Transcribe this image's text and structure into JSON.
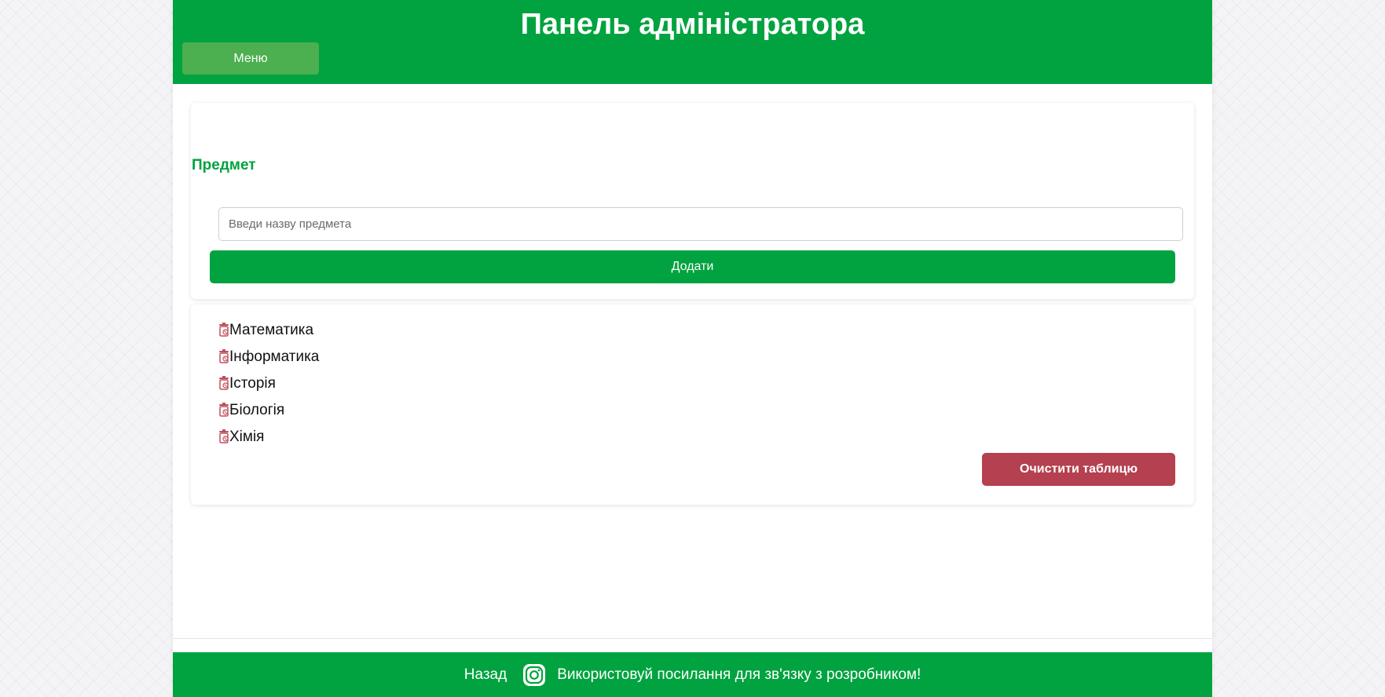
{
  "header": {
    "title": "Панель адміністратора",
    "menu_label": "Меню"
  },
  "form": {
    "section_title": "Предмет",
    "input_placeholder": "Введи назву предмета",
    "input_value": "",
    "add_label": "Додати"
  },
  "subjects": [
    {
      "label": "Математика",
      "icon": "trash-icon"
    },
    {
      "label": "Інформатика",
      "icon": "trash-icon"
    },
    {
      "label": "Історія",
      "icon": "trash-icon"
    },
    {
      "label": "Біологія",
      "icon": "trash-icon"
    },
    {
      "label": "Хімія",
      "icon": "trash-icon"
    }
  ],
  "clear_label": "Очистити таблицю",
  "footer": {
    "back_label": "Назад",
    "icon": "instagram-icon",
    "contact_text": "Використовуй посилання для зв'язку з розробником!"
  },
  "colors": {
    "brand_green": "#00a33f",
    "menu_green": "#4caf50",
    "danger": "#b5404f",
    "trash_icon": "#c0505c"
  }
}
